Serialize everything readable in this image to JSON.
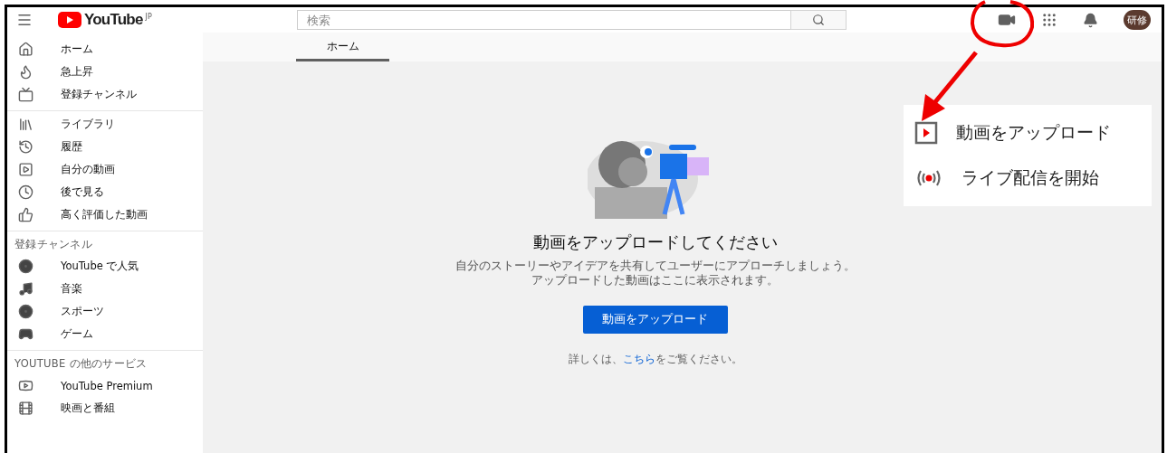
{
  "header": {
    "logo_text": "YouTube",
    "logo_region": "JP",
    "search": {
      "placeholder": "検索"
    },
    "avatar": "研修"
  },
  "sidebar": {
    "sections": [
      {
        "items": [
          {
            "label": "ホーム"
          },
          {
            "label": "急上昇"
          },
          {
            "label": "登録チャンネル"
          }
        ]
      },
      {
        "items": [
          {
            "label": "ライブラリ"
          },
          {
            "label": "履歴"
          },
          {
            "label": "自分の動画"
          },
          {
            "label": "後で見る"
          },
          {
            "label": "高く評価した動画"
          }
        ]
      },
      {
        "title": "登録チャンネル",
        "items": [
          {
            "label": "YouTube で人気"
          },
          {
            "label": "音楽"
          },
          {
            "label": "スポーツ"
          },
          {
            "label": "ゲーム"
          }
        ]
      },
      {
        "title": "YOUTUBE の他のサービス",
        "items": [
          {
            "label": "YouTube Premium"
          },
          {
            "label": "映画と番組"
          }
        ]
      }
    ]
  },
  "tabs": [
    {
      "label": "ホーム",
      "selected": true
    }
  ],
  "empty_state": {
    "title": "動画をアップロードしてください",
    "lines": [
      "自分のストーリーやアイデアを共有してユーザーにアプローチしましょう。",
      "アップロードした動画はここに表示されます。"
    ],
    "button": "動画をアップロード",
    "more_info": {
      "before": "詳しくは、",
      "link": "こちら",
      "after": "をご覧ください。"
    }
  },
  "popup_menu": {
    "items": [
      {
        "kind": "upload",
        "label": "動画をアップロード"
      },
      {
        "kind": "live",
        "label": "ライブ配信を開始"
      }
    ]
  }
}
